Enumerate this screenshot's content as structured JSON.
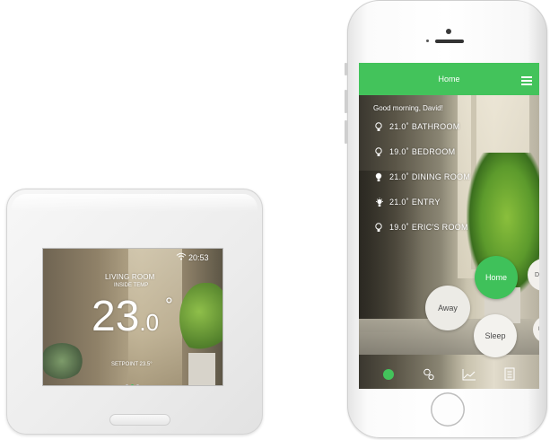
{
  "thermostat": {
    "time": "20:53",
    "room": "LIVING ROOM",
    "inside_label": "INSIDE TEMP",
    "temp_main": "23",
    "temp_decimal": ".0",
    "degree": "°",
    "setpoint": "SETPOINT 23.5°",
    "page_dots": 3,
    "active_dot": 1,
    "wifi_icon": "wifi-icon"
  },
  "app": {
    "title": "Home",
    "accent_color": "#43c35b",
    "greeting": "Good morning, David!",
    "rooms": [
      {
        "temp": "21.0˚",
        "name": "BATHROOM",
        "icon": "bulb-off-icon"
      },
      {
        "temp": "19.0˚",
        "name": "BEDROOM",
        "icon": "bulb-off-icon"
      },
      {
        "temp": "21.0˚",
        "name": "DINING ROOM",
        "icon": "bulb-on-icon"
      },
      {
        "temp": "21.0˚",
        "name": "ENTRY",
        "icon": "bulb-on-icon"
      },
      {
        "temp": "19.0˚",
        "name": "ERIC'S ROOM",
        "icon": "bulb-off-icon"
      }
    ],
    "modes": {
      "home": "Home",
      "date": "Dat",
      "away": "Away",
      "sleep": "Sleep",
      "re": "Re"
    },
    "nav_icons": [
      "home-nav-icon",
      "rooms-icon",
      "chart-icon",
      "schedule-icon"
    ]
  }
}
